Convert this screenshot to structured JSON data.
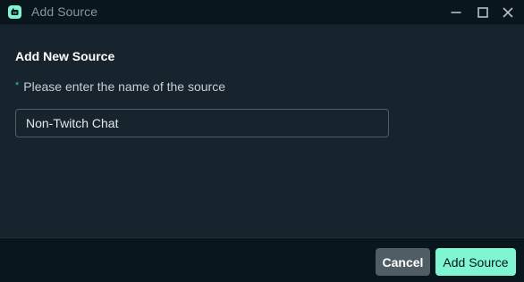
{
  "window": {
    "title": "Add Source",
    "icon": "streamlabs-app-icon",
    "controls": {
      "minimize_icon": "minimize-icon",
      "maximize_icon": "maximize-icon",
      "close_icon": "close-icon"
    }
  },
  "form": {
    "heading": "Add New Source",
    "required_marker": "*",
    "name_label": "Please enter the name of the source",
    "name_value": "Non-Twitch Chat"
  },
  "footer": {
    "cancel_label": "Cancel",
    "add_label": "Add Source"
  },
  "colors": {
    "accent": "#80f5d2",
    "required_star": "#31c3a2",
    "background": "#17242d",
    "titlebar": "#09161d",
    "button_secondary": "#4f5e65"
  }
}
